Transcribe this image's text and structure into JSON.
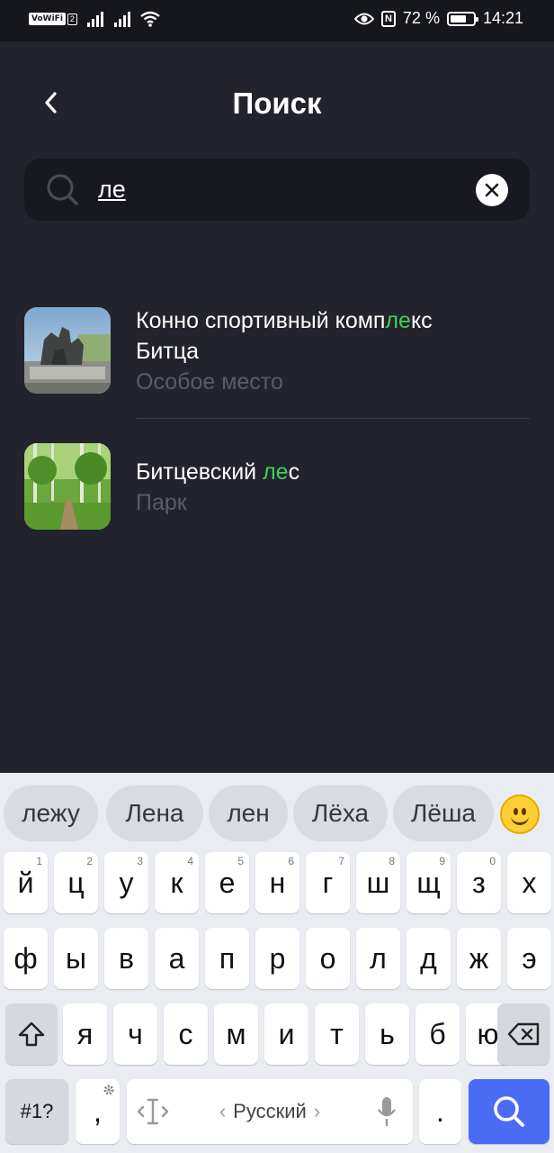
{
  "status_bar": {
    "volte_label": "VoWiFi",
    "volte_number": "2",
    "battery_percent": "72 %",
    "battery_level": 0.72,
    "nfc_label": "N",
    "time": "14:21"
  },
  "header": {
    "title": "Поиск"
  },
  "search": {
    "value": "ле"
  },
  "results": [
    {
      "title_before": "Конно спортивный комп",
      "title_match": "ле",
      "title_after": "кс",
      "title_line2": "Битца",
      "subtitle": "Особое место"
    },
    {
      "title_before": "Битцевский ",
      "title_match": "ле",
      "title_after": "с",
      "subtitle": "Парк"
    }
  ],
  "keyboard": {
    "suggestions": [
      "лежу",
      "Лена",
      "лен",
      "Лёха",
      "Лёша"
    ],
    "row1": [
      {
        "key": "й",
        "hint": "1"
      },
      {
        "key": "ц",
        "hint": "2"
      },
      {
        "key": "у",
        "hint": "3"
      },
      {
        "key": "к",
        "hint": "4"
      },
      {
        "key": "е",
        "hint": "5"
      },
      {
        "key": "н",
        "hint": "6"
      },
      {
        "key": "г",
        "hint": "7"
      },
      {
        "key": "ш",
        "hint": "8"
      },
      {
        "key": "щ",
        "hint": "9"
      },
      {
        "key": "з",
        "hint": "0"
      },
      {
        "key": "х",
        "hint": ""
      }
    ],
    "row2": [
      "ф",
      "ы",
      "в",
      "а",
      "п",
      "р",
      "о",
      "л",
      "д",
      "ж",
      "э"
    ],
    "row3": [
      "я",
      "ч",
      "с",
      "м",
      "и",
      "т",
      "ь",
      "б",
      "ю"
    ],
    "symbols_label": "#1?",
    "comma_label": ",",
    "language_label": "Русский",
    "period_label": "."
  },
  "colors": {
    "background": "#22232c",
    "highlight": "#3fcf5a",
    "search_key": "#4a6cf5"
  }
}
